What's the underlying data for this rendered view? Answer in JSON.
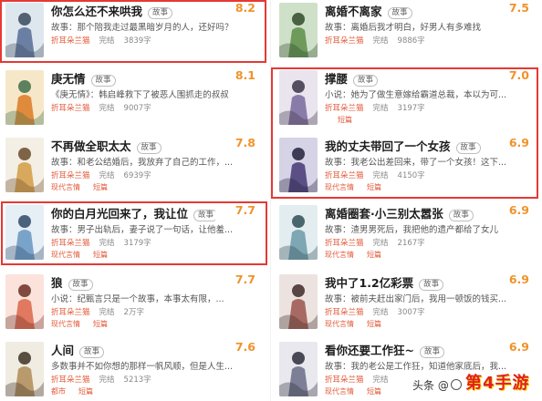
{
  "books": [
    {
      "title": "你怎么还不来哄我",
      "tag": "故事",
      "rating": "8.2",
      "summary": "故事：那个陪我走过最黑暗岁月的人，还好吗？",
      "author": "折耳朵兰猫",
      "status": "完结",
      "words": "3839字",
      "genre": "",
      "cat": "",
      "colors": [
        "#dfe7ee",
        "#6b7fa3",
        "#3b4a5c"
      ]
    },
    {
      "title": "离婚不离家",
      "tag": "故事",
      "rating": "7.5",
      "summary": "故事：离婚后我才明白，好男人有多难找",
      "author": "折耳朵兰猫",
      "status": "完结",
      "words": "9886字",
      "genre": "",
      "cat": "",
      "colors": [
        "#cfe0c8",
        "#6e9a5b",
        "#2f4a2a"
      ]
    },
    {
      "title": "庚无情",
      "tag": "故事",
      "rating": "8.1",
      "summary": "《庚无情》：韩启峰救下了被恶人围抓走的叔叔",
      "author": "折耳朵兰猫",
      "status": "完结",
      "words": "9007字",
      "genre": "",
      "cat": "",
      "colors": [
        "#f6e7c8",
        "#e08a3c",
        "#3f6f4a"
      ]
    },
    {
      "title": "撑腰",
      "tag": "故事",
      "rating": "7.0",
      "summary": "小说：她为了做生意嫁给霸道总裁，本以为可...",
      "author": "折耳朵兰猫",
      "status": "完结",
      "words": "3197字",
      "genre": "",
      "cat": "短篇",
      "colors": [
        "#e9e4ee",
        "#8a7ca8",
        "#3b3347"
      ]
    },
    {
      "title": "不再做全职太太",
      "tag": "故事",
      "rating": "7.8",
      "summary": "故事：和老公结婚后，我放弃了自己的工作，...",
      "author": "折耳朵兰猫",
      "status": "完结",
      "words": "6939字",
      "genre": "现代言情",
      "cat": "短篇",
      "colors": [
        "#f4efe4",
        "#d8a85c",
        "#6a4a2a"
      ]
    },
    {
      "title": "我的丈夫带回了一个女孩",
      "tag": "故事",
      "rating": "6.9",
      "summary": "故事：我老公出差回来，带了一个女孩！这下...",
      "author": "折耳朵兰猫",
      "status": "完结",
      "words": "4150字",
      "genre": "现代言情",
      "cat": "短篇",
      "colors": [
        "#d6d3e6",
        "#5c4f86",
        "#23203a"
      ]
    },
    {
      "title": "你的白月光回来了，我让位",
      "tag": "故事",
      "rating": "7.7",
      "summary": "故事：男子出轨后，妻子说了一句话，让他羞...",
      "author": "折耳朵兰猫",
      "status": "完结",
      "words": "3179字",
      "genre": "现代言情",
      "cat": "短篇",
      "colors": [
        "#e6eef6",
        "#7aa3c9",
        "#2e4a66"
      ]
    },
    {
      "title": "离婚圈套·小三别太嚣张",
      "tag": "故事",
      "rating": "6.9",
      "summary": "故事：渣男男死后，我把他的遗产都给了女儿",
      "author": "折耳朵兰猫",
      "status": "完结",
      "words": "2167字",
      "genre": "现代言情",
      "cat": "短篇",
      "colors": [
        "#e3edf0",
        "#7ea6b3",
        "#2f4d56"
      ]
    },
    {
      "title": "狼",
      "tag": "故事",
      "rating": "7.7",
      "summary": "小说：纪甄言只是一个故事，本事太有限，...",
      "author": "折耳朵兰猫",
      "status": "完结",
      "words": "2万字",
      "genre": "现代言情",
      "cat": "短篇",
      "colors": [
        "#fbe3dc",
        "#e0795f",
        "#6a2f25"
      ]
    },
    {
      "title": "我中了1.2亿彩票",
      "tag": "故事",
      "rating": "6.9",
      "summary": "故事：被前夫赶出家门后，我用一顿饭的钱买...",
      "author": "折耳朵兰猫",
      "status": "完结",
      "words": "3007字",
      "genre": "现代言情",
      "cat": "短篇",
      "colors": [
        "#ece3e0",
        "#a66a62",
        "#3f2a28"
      ]
    },
    {
      "title": "人间",
      "tag": "故事",
      "rating": "7.6",
      "summary": "多数事并不如你想的那样一帆风顺，但是人生...",
      "author": "折耳朵兰猫",
      "status": "完结",
      "words": "5213字",
      "genre": "都市",
      "cat": "短篇",
      "colors": [
        "#f1ece2",
        "#b89a6c",
        "#3d3224"
      ]
    },
    {
      "title": "看你还要工作狂~",
      "tag": "故事",
      "rating": "6.9",
      "summary": "故事：我的老公是工作狂，知道他家底后，我...",
      "author": "折耳朵兰猫",
      "status": "完结",
      "words": "",
      "genre": "现代言情",
      "cat": "短篇",
      "colors": [
        "#e8e8ee",
        "#7d7f96",
        "#2c2d3a"
      ]
    }
  ],
  "watermark": {
    "text": "头条 @",
    "logo": "第4手游"
  },
  "highlight_color": "#e53935"
}
